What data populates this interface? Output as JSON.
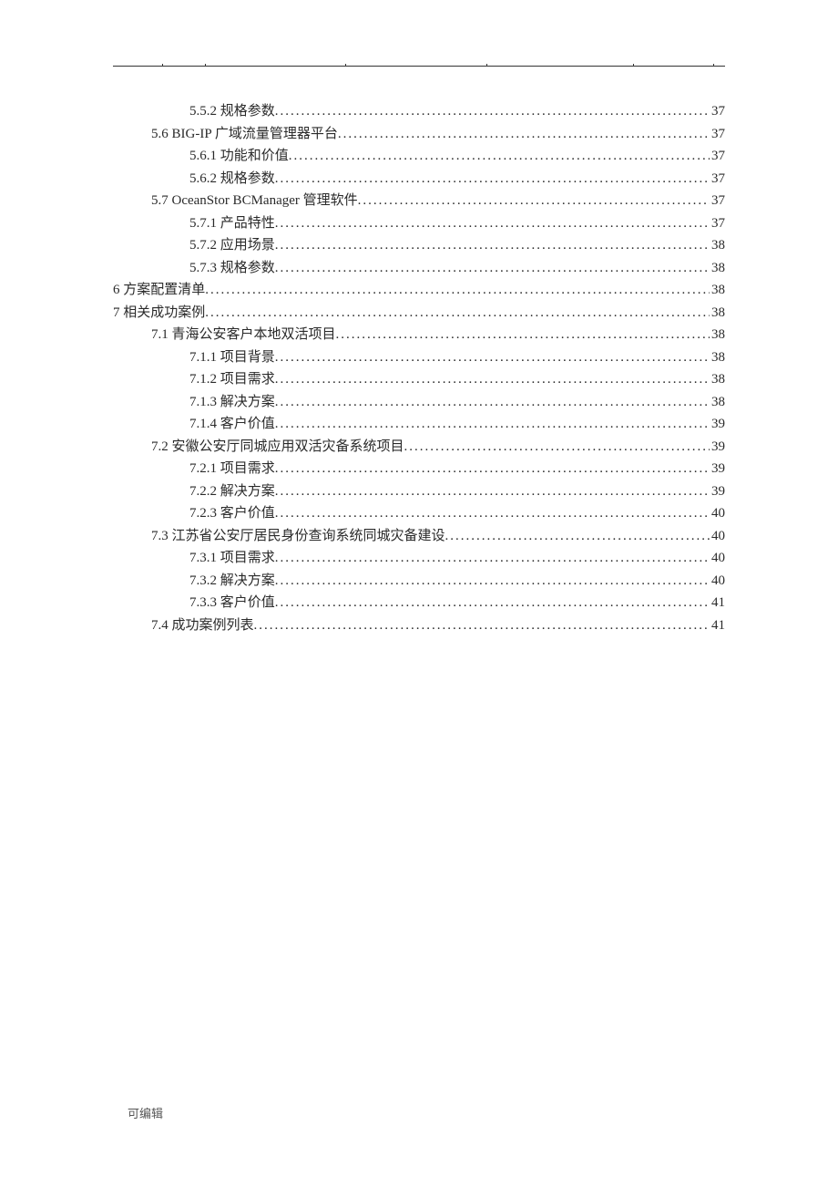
{
  "footer": "可编辑",
  "toc": [
    {
      "level": 2,
      "label": "5.5.2 规格参数",
      "page": "37"
    },
    {
      "level": 1,
      "label": "5.6 BIG-IP 广域流量管理器平台",
      "page": "37"
    },
    {
      "level": 2,
      "label": "5.6.1 功能和价值",
      "page": "37"
    },
    {
      "level": 2,
      "label": "5.6.2 规格参数",
      "page": "37"
    },
    {
      "level": 1,
      "label": "5.7 OceanStor BCManager 管理软件",
      "page": "37"
    },
    {
      "level": 2,
      "label": "5.7.1 产品特性",
      "page": "37"
    },
    {
      "level": 2,
      "label": "5.7.2 应用场景",
      "page": "38"
    },
    {
      "level": 2,
      "label": "5.7.3 规格参数",
      "page": "38"
    },
    {
      "level": 0,
      "label": "6 方案配置清单",
      "page": "38"
    },
    {
      "level": 0,
      "label": "7 相关成功案例",
      "page": "38"
    },
    {
      "level": 1,
      "label": "7.1 青海公安客户本地双活项目",
      "page": "38"
    },
    {
      "level": 2,
      "label": "7.1.1 项目背景",
      "page": "38"
    },
    {
      "level": 2,
      "label": "7.1.2 项目需求",
      "page": "38"
    },
    {
      "level": 2,
      "label": "7.1.3 解决方案",
      "page": "38"
    },
    {
      "level": 2,
      "label": "7.1.4 客户价值",
      "page": "39"
    },
    {
      "level": 1,
      "label": "7.2 安徽公安厅同城应用双活灾备系统项目",
      "page": "39"
    },
    {
      "level": 2,
      "label": "7.2.1 项目需求",
      "page": "39"
    },
    {
      "level": 2,
      "label": "7.2.2 解决方案",
      "page": "39"
    },
    {
      "level": 2,
      "label": "7.2.3 客户价值",
      "page": "40"
    },
    {
      "level": 1,
      "label": "7.3 江苏省公安厅居民身份查询系统同城灾备建设",
      "page": "40"
    },
    {
      "level": 2,
      "label": "7.3.1 项目需求",
      "page": "40"
    },
    {
      "level": 2,
      "label": "7.3.2 解决方案",
      "page": "40"
    },
    {
      "level": 2,
      "label": "7.3.3 客户价值",
      "page": "41"
    },
    {
      "level": 1,
      "label": "7.4 成功案例列表",
      "page": "41"
    }
  ],
  "ticks_percent": [
    8,
    15,
    38,
    61,
    85,
    98
  ]
}
